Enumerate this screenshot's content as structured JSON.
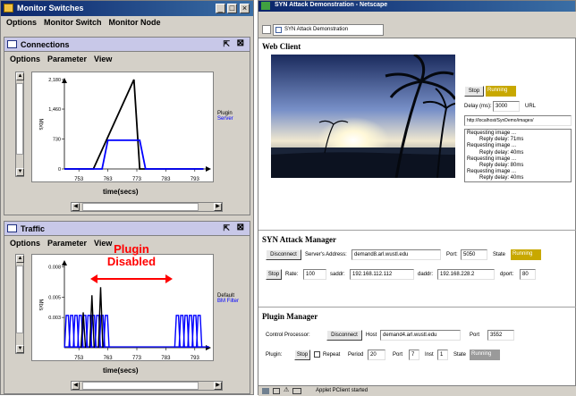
{
  "monitor": {
    "title": "Monitor Switches",
    "controls": [
      "_",
      "□",
      "×"
    ],
    "menu": [
      "Options",
      "Monitor Switch",
      "Monitor Node"
    ],
    "connections": {
      "title": "Connections",
      "menu": [
        "Options",
        "Parameter",
        "View"
      ],
      "ylabel": "Mb/s",
      "xlabel": "time(secs)",
      "legend": [
        {
          "name": "Plugin",
          "color": "#000000"
        },
        {
          "name": "Server",
          "color": "#0000ff"
        }
      ]
    },
    "traffic": {
      "title": "Traffic",
      "menu": [
        "Options",
        "Parameter",
        "View"
      ],
      "ylabel": "Mb/s",
      "xlabel": "time(secs)",
      "legend": [
        {
          "name": "Default",
          "color": "#000000"
        },
        {
          "name": "BM Filter",
          "color": "#0000ff"
        }
      ],
      "annotation_line1": "Plugin",
      "annotation_line2": "Disabled",
      "annotation_color": "#ff0000"
    }
  },
  "chart_data": [
    {
      "type": "line",
      "title": "Connections",
      "xlabel": "time(secs)",
      "ylabel": "Mb/s",
      "xticks": [
        "753",
        "763",
        "773",
        "783",
        "793"
      ],
      "yticks": [
        "2,180",
        "1,460",
        "730",
        "0"
      ],
      "xlim": [
        748,
        798
      ],
      "ylim": [
        0,
        2180
      ],
      "series": [
        {
          "name": "Plugin",
          "color": "#000000",
          "x": [
            748,
            758,
            772,
            774,
            796
          ],
          "y": [
            0,
            0,
            2180,
            0,
            0
          ]
        },
        {
          "name": "Server",
          "color": "#0000ff",
          "x": [
            748,
            761,
            763,
            774,
            776,
            796
          ],
          "y": [
            0,
            0,
            700,
            700,
            0,
            0
          ]
        }
      ]
    },
    {
      "type": "line",
      "title": "Traffic",
      "xlabel": "time(secs)",
      "ylabel": "Mb/s",
      "xticks": [
        "753",
        "763",
        "773",
        "783",
        "793"
      ],
      "yticks": [
        "0.008",
        "0.005",
        "0.003"
      ],
      "xlim": [
        748,
        798
      ],
      "ylim": [
        0,
        0.0085
      ],
      "series": [
        {
          "name": "Default",
          "color": "#000000",
          "peaks_x": [
            754.5,
            757.5,
            760.5
          ],
          "peaks_y": [
            0.0035,
            0.0052,
            0.006
          ]
        },
        {
          "name": "BM Filter",
          "color": "#0000ff",
          "peaks_x": [
            749,
            750.5,
            752,
            753.5,
            755,
            756.5,
            758,
            759.5,
            761,
            762.5,
            787,
            788.5,
            790,
            791.5,
            793,
            794.5
          ],
          "peaks_y": [
            0.0032,
            0.0032,
            0.0032,
            0.0032,
            0.0032,
            0.0032,
            0.0032,
            0.0032,
            0.0032,
            0.0032,
            0.0032,
            0.0032,
            0.0032,
            0.0032,
            0.0032,
            0.0032
          ]
        }
      ]
    }
  ],
  "browser": {
    "title": "SYN Attack Demonstration - Netscape",
    "tab": "SYN Attack Demonstration",
    "web_client": {
      "heading": "Web Client",
      "stop": "Stop",
      "status": "Running",
      "delay_label": "Delay (ms):",
      "delay_value": "3000",
      "url_label": "URL",
      "url_value": "http://localhost/SynDemo/images/",
      "log": [
        "Requesting image ...",
        "Reply delay: 71ms",
        "Requesting image ...",
        "Reply delay: 40ms",
        "Requesting image ...",
        "Reply delay: 80ms",
        "Requesting image ...",
        "Reply delay: 40ms"
      ]
    },
    "syn_manager": {
      "heading": "SYN Attack Manager",
      "disconnect": "Disconnect",
      "server_label": "Server's Address:",
      "server_value": "demand8.arl.wustl.edu",
      "port_label": "Port:",
      "port_value": "5050",
      "state_label": "State",
      "state_value": "Running",
      "stop": "Stop",
      "rate_label": "Rate:",
      "rate_value": "100",
      "saddr_label": "saddr:",
      "saddr_value": "192.168.112.112",
      "daddr_label": "daddr:",
      "daddr_value": "192.168.228.2",
      "dport_label": "dport:",
      "dport_value": "80"
    },
    "plugin_manager": {
      "heading": "Plugin Manager",
      "cp_label": "Control Processor:",
      "disconnect": "Disconnect",
      "host_label": "Host",
      "host_value": "demand4.arl.wustl.edu",
      "port_label": "Port",
      "port_value": "3552",
      "plugin_label": "Plugin:",
      "stop": "Stop",
      "repeat_label": "Repeat",
      "period_label": "Period",
      "period_value": "20",
      "port2_label": "Port",
      "port2_value": "7",
      "inst_label": "Inst",
      "inst_value": "1",
      "state_label": "State",
      "state_value": "Running"
    },
    "statusbar": "Applet PClient started"
  },
  "colors": {
    "running_bg": "#c8a800",
    "grey_running": "#9a9a9a"
  }
}
